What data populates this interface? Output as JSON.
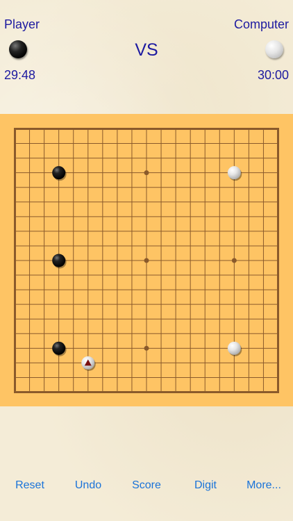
{
  "header": {
    "player_label": "Player",
    "computer_label": "Computer",
    "vs_label": "VS",
    "player_time": "29:48",
    "computer_time": "30:00",
    "player_stone_color": "black",
    "computer_stone_color": "white"
  },
  "board": {
    "size": 19,
    "star_points": [
      [
        3,
        3
      ],
      [
        3,
        9
      ],
      [
        3,
        15
      ],
      [
        9,
        3
      ],
      [
        9,
        9
      ],
      [
        9,
        15
      ],
      [
        15,
        3
      ],
      [
        15,
        9
      ],
      [
        15,
        15
      ]
    ],
    "stones": [
      {
        "col": 3,
        "row": 3,
        "color": "black"
      },
      {
        "col": 3,
        "row": 9,
        "color": "black"
      },
      {
        "col": 3,
        "row": 15,
        "color": "black"
      },
      {
        "col": 15,
        "row": 3,
        "color": "white"
      },
      {
        "col": 15,
        "row": 15,
        "color": "white"
      },
      {
        "col": 5,
        "row": 16,
        "color": "white",
        "last_move": true
      }
    ],
    "colors": {
      "board": "#fec464",
      "lines": "#8a5a2b",
      "last_move_marker": "#7a1010"
    }
  },
  "toolbar": {
    "buttons": [
      {
        "id": "reset",
        "label": "Reset"
      },
      {
        "id": "undo",
        "label": "Undo"
      },
      {
        "id": "score",
        "label": "Score"
      },
      {
        "id": "digit",
        "label": "Digit"
      },
      {
        "id": "more",
        "label": "More..."
      }
    ],
    "color": "#1a73d9"
  },
  "text_color": "#1d1aa0"
}
